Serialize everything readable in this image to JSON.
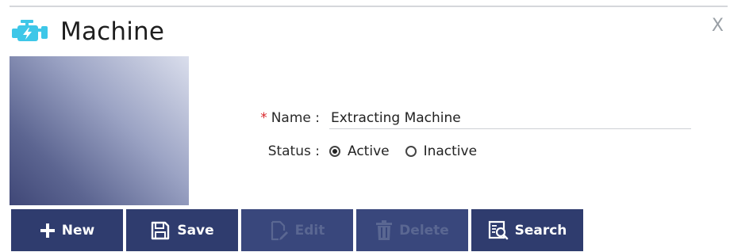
{
  "window": {
    "title": "Machine",
    "close_label": "X"
  },
  "form": {
    "name_label": "Name :",
    "name_required_marker": "*",
    "name_value": "Extracting Machine",
    "status_label": "Status :",
    "status_options": [
      {
        "label": "Active",
        "checked": true
      },
      {
        "label": "Inactive",
        "checked": false
      }
    ]
  },
  "toolbar": {
    "new_label": "New",
    "save_label": "Save",
    "edit_label": "Edit",
    "delete_label": "Delete",
    "search_label": "Search"
  },
  "colors": {
    "toolbar_bg": "#2f3c6e",
    "toolbar_disabled_text": "#5a6792",
    "required": "#d9262b",
    "icon_accent": "#3ec7e8"
  },
  "icons": {
    "title": "engine-icon",
    "new": "plus-icon",
    "save": "floppy-disk-icon",
    "edit": "edit-document-icon",
    "delete": "trash-icon",
    "search": "search-document-icon"
  }
}
